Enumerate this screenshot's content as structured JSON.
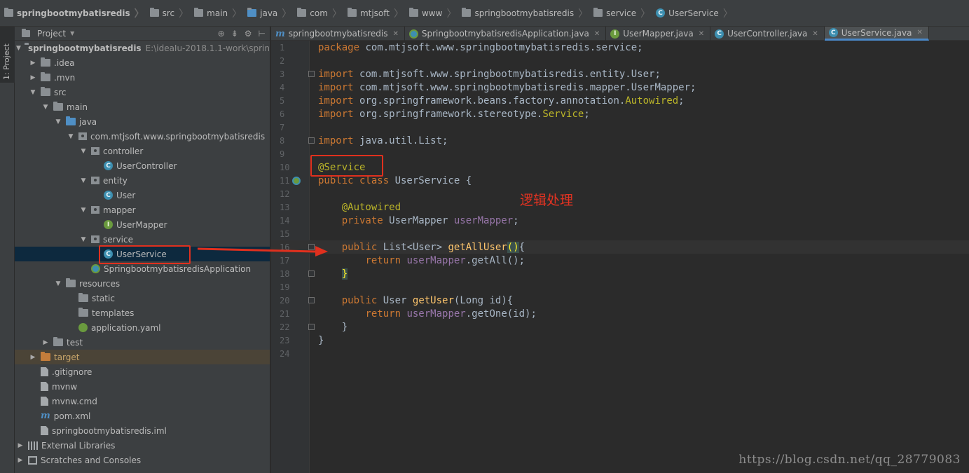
{
  "breadcrumb": [
    {
      "label": "springbootmybatisredis",
      "icon": "module-folder-icon",
      "bold": true
    },
    {
      "label": "src",
      "icon": "folder-icon"
    },
    {
      "label": "main",
      "icon": "folder-icon"
    },
    {
      "label": "java",
      "icon": "source-folder-icon"
    },
    {
      "label": "com",
      "icon": "folder-icon"
    },
    {
      "label": "mtjsoft",
      "icon": "folder-icon"
    },
    {
      "label": "www",
      "icon": "folder-icon"
    },
    {
      "label": "springbootmybatisredis",
      "icon": "folder-icon"
    },
    {
      "label": "service",
      "icon": "folder-icon"
    },
    {
      "label": "UserService",
      "icon": "class-icon"
    }
  ],
  "side_strip": {
    "tab_label": "1: Project"
  },
  "project": {
    "title": "Project",
    "tree": [
      {
        "label": "springbootmybatisredis",
        "path": "E:\\ideaIu-2018.1.1-work\\sprin",
        "depth": 0,
        "arrow": "down",
        "icon": "module",
        "bold": true
      },
      {
        "label": ".idea",
        "depth": 1,
        "arrow": "right",
        "icon": "folder"
      },
      {
        "label": ".mvn",
        "depth": 1,
        "arrow": "right",
        "icon": "folder"
      },
      {
        "label": "src",
        "depth": 1,
        "arrow": "down",
        "icon": "folder"
      },
      {
        "label": "main",
        "depth": 2,
        "arrow": "down",
        "icon": "folder"
      },
      {
        "label": "java",
        "depth": 3,
        "arrow": "down",
        "icon": "src"
      },
      {
        "label": "com.mtjsoft.www.springbootmybatisredis",
        "depth": 4,
        "arrow": "down",
        "icon": "package"
      },
      {
        "label": "controller",
        "depth": 5,
        "arrow": "down",
        "icon": "package"
      },
      {
        "label": "UserController",
        "depth": 6,
        "arrow": "",
        "icon": "class"
      },
      {
        "label": "entity",
        "depth": 5,
        "arrow": "down",
        "icon": "package"
      },
      {
        "label": "User",
        "depth": 6,
        "arrow": "",
        "icon": "class"
      },
      {
        "label": "mapper",
        "depth": 5,
        "arrow": "down",
        "icon": "package"
      },
      {
        "label": "UserMapper",
        "depth": 6,
        "arrow": "",
        "icon": "interface"
      },
      {
        "label": "service",
        "depth": 5,
        "arrow": "down",
        "icon": "package"
      },
      {
        "label": "UserService",
        "depth": 6,
        "arrow": "",
        "icon": "class",
        "selected": true
      },
      {
        "label": "SpringbootmybatisredisApplication",
        "depth": 5,
        "arrow": "",
        "icon": "spring"
      },
      {
        "label": "resources",
        "depth": 3,
        "arrow": "down",
        "icon": "res"
      },
      {
        "label": "static",
        "depth": 4,
        "arrow": "",
        "icon": "folder"
      },
      {
        "label": "templates",
        "depth": 4,
        "arrow": "",
        "icon": "folder"
      },
      {
        "label": "application.yaml",
        "depth": 4,
        "arrow": "",
        "icon": "yaml"
      },
      {
        "label": "test",
        "depth": 2,
        "arrow": "right",
        "icon": "folder"
      },
      {
        "label": "target",
        "depth": 1,
        "arrow": "right",
        "icon": "excluded",
        "highlight": true
      },
      {
        "label": ".gitignore",
        "depth": 1,
        "arrow": "",
        "icon": "file"
      },
      {
        "label": "mvnw",
        "depth": 1,
        "arrow": "",
        "icon": "file"
      },
      {
        "label": "mvnw.cmd",
        "depth": 1,
        "arrow": "",
        "icon": "file"
      },
      {
        "label": "pom.xml",
        "depth": 1,
        "arrow": "",
        "icon": "maven"
      },
      {
        "label": "springbootmybatisredis.iml",
        "depth": 1,
        "arrow": "",
        "icon": "file"
      },
      {
        "label": "External Libraries",
        "depth": 0,
        "arrow": "right",
        "icon": "libs"
      },
      {
        "label": "Scratches and Consoles",
        "depth": 0,
        "arrow": "right",
        "icon": "scratch"
      }
    ]
  },
  "editor": {
    "tabs": [
      {
        "label": "springbootmybatisredis",
        "icon": "maven-icon"
      },
      {
        "label": "SpringbootmybatisredisApplication.java",
        "icon": "spring-class-icon"
      },
      {
        "label": "UserMapper.java",
        "icon": "interface-icon"
      },
      {
        "label": "UserController.java",
        "icon": "class-icon"
      },
      {
        "label": "UserService.java",
        "icon": "class-icon",
        "active": true
      }
    ],
    "lines": [
      [
        [
          "kw",
          "package "
        ],
        [
          "t",
          "com.mtjsoft.www.springbootmybatisredis.service;"
        ]
      ],
      [],
      [
        [
          "kw",
          "import "
        ],
        [
          "t",
          "com.mtjsoft.www.springbootmybatisredis.entity.User;"
        ]
      ],
      [
        [
          "kw",
          "import "
        ],
        [
          "t",
          "com.mtjsoft.www.springbootmybatisredis.mapper.UserMapper;"
        ]
      ],
      [
        [
          "kw",
          "import "
        ],
        [
          "t",
          "org.springframework.beans.factory.annotation."
        ],
        [
          "ann",
          "Autowired"
        ],
        [
          "t",
          ";"
        ]
      ],
      [
        [
          "kw",
          "import "
        ],
        [
          "t",
          "org.springframework.stereotype."
        ],
        [
          "ann",
          "Service"
        ],
        [
          "t",
          ";"
        ]
      ],
      [],
      [
        [
          "kw",
          "import "
        ],
        [
          "t",
          "java.util.List;"
        ]
      ],
      [],
      [
        [
          "ann",
          "@Service"
        ]
      ],
      [
        [
          "kw",
          "public class "
        ],
        [
          "t",
          "UserService {"
        ]
      ],
      [],
      [
        [
          "t",
          "    "
        ],
        [
          "ann",
          "@Autowired"
        ]
      ],
      [
        [
          "t",
          "    "
        ],
        [
          "kw",
          "private "
        ],
        [
          "t",
          "UserMapper "
        ],
        [
          "fld",
          "userMapper"
        ],
        [
          "t",
          ";"
        ]
      ],
      [],
      [
        [
          "t",
          "    "
        ],
        [
          "kw",
          "public "
        ],
        [
          "t",
          "List<User> "
        ],
        [
          "fn",
          "getAllUser"
        ],
        [
          "hl",
          "("
        ],
        [
          "hl",
          ")"
        ],
        [
          "t",
          "{"
        ]
      ],
      [
        [
          "t",
          "        "
        ],
        [
          "kw",
          "return "
        ],
        [
          "fld",
          "userMapper"
        ],
        [
          "t",
          ".getAll();"
        ]
      ],
      [
        [
          "t",
          "    "
        ],
        [
          "hl",
          "}"
        ]
      ],
      [],
      [
        [
          "t",
          "    "
        ],
        [
          "kw",
          "public "
        ],
        [
          "t",
          "User "
        ],
        [
          "fn",
          "getUser"
        ],
        [
          "t",
          "(Long id){"
        ]
      ],
      [
        [
          "t",
          "        "
        ],
        [
          "kw",
          "return "
        ],
        [
          "fld",
          "userMapper"
        ],
        [
          "t",
          ".getOne(id);"
        ]
      ],
      [
        [
          "t",
          "    }"
        ]
      ],
      [
        [
          "t",
          "}"
        ]
      ],
      []
    ]
  },
  "annotation_note": "逻辑处理",
  "watermark": "https://blog.csdn.net/qq_28779083"
}
